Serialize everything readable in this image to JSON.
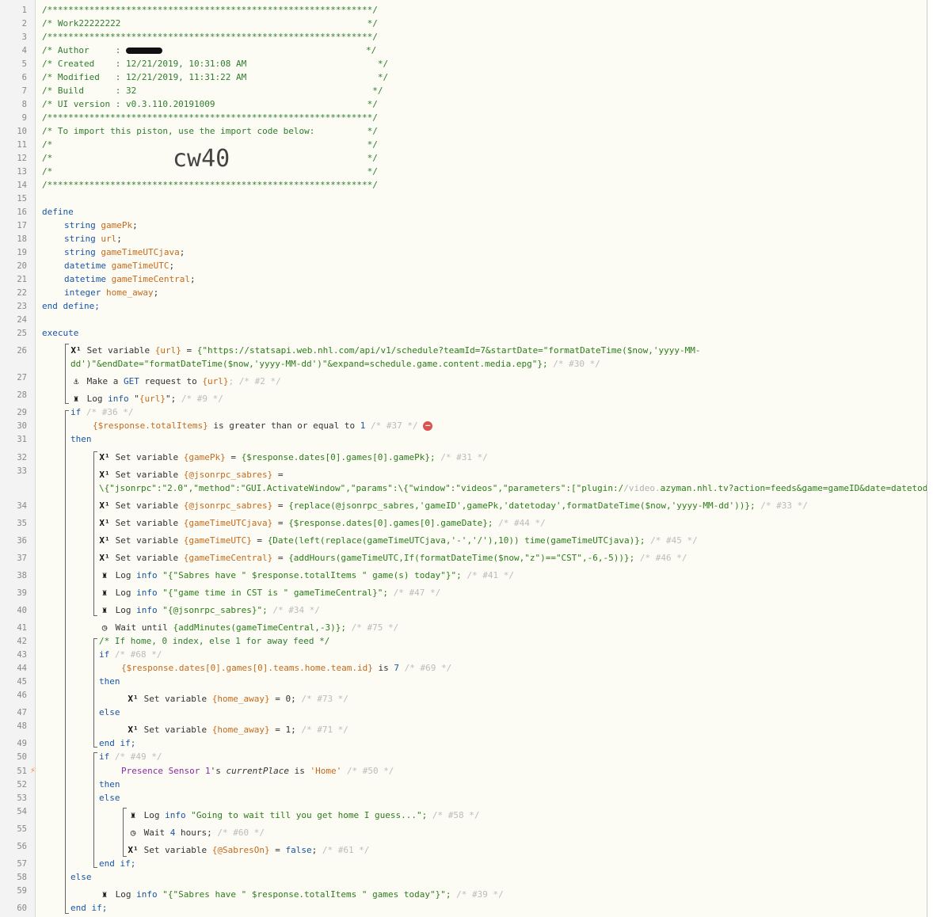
{
  "gutter": {
    "line_numbers": [
      "1",
      "2",
      "3",
      "4",
      "5",
      "6",
      "7",
      "8",
      "9",
      "10",
      "11",
      "12",
      "13",
      "14",
      "15",
      "16",
      "17",
      "18",
      "19",
      "20",
      "21",
      "22",
      "23",
      "24",
      "25",
      "26",
      "27",
      "28",
      "29",
      "30",
      "31",
      "32",
      "33",
      "34",
      "35",
      "36",
      "37",
      "38",
      "39",
      "40",
      "41",
      "42",
      "43",
      "44",
      "45",
      "46",
      "47",
      "48",
      "49",
      "50",
      "51",
      "52",
      "53",
      "54",
      "55",
      "56",
      "57",
      "58",
      "59",
      "60"
    ]
  },
  "header": {
    "stars": "/**************************************************************/",
    "title": "/* Work22222222                                               */",
    "author": "/* Author     :",
    "author_end": "*/",
    "created": "/* Created    : 12/21/2019, 10:31:08 AM                         */",
    "modified": "/* Modified   : 12/21/2019, 11:31:22 AM                         */",
    "build": "/* Build      : 32                                             */",
    "ui_version": "/* UI version : v0.3.110.20191009                             */",
    "import_line": "/* To import this piston, use the import code below:          */",
    "blank": "/*                                                            */",
    "blank_short": "/*                                                            */",
    "import_code": "cw40"
  },
  "define": {
    "kw": "define",
    "vars": [
      {
        "type": "string",
        "name": "gamePk"
      },
      {
        "type": "string",
        "name": "url"
      },
      {
        "type": "string",
        "name": "gameTimeUTCjava"
      },
      {
        "type": "datetime",
        "name": "gameTimeUTC"
      },
      {
        "type": "datetime",
        "name": "gameTimeCentral"
      },
      {
        "type": "integer",
        "name": "home_away"
      }
    ],
    "end": "end define;"
  },
  "execute": {
    "kw": "execute",
    "l26a": "Set variable ",
    "l26var": "{url}",
    "l26b": " = ",
    "l26expr": "{\"https://statsapi.web.nhl.com/api/v1/schedule?teamId=7&startDate=\"formatDateTime($now,'yyyy-MM-",
    "l26expr2": "dd')\"&endDate=\"formatDateTime($now,'yyyy-MM-dd')\"&expand=schedule.game.content.media.epg\"};",
    "l26id": " /* #30 */",
    "l27a": "Make a ",
    "l27b": "GET",
    "l27c": " request to ",
    "l27var": "{url}",
    "l27id": "; /* #2 */",
    "l28a": "Log ",
    "l28b": "info",
    "l28c": " \"",
    "l28var": "{url}",
    "l28d": "\";",
    "l28id": " /* #9 */",
    "if_kw": "if",
    "l29id": " /* #36 */",
    "l30a": "{$response.totalItems}",
    "l30b": " is greater than or equal to ",
    "l30c": "1",
    "l30id": " /* #37 */",
    "then_kw": "then",
    "l32var": "{gamePk}",
    "l32expr": "{$response.dates[0].games[0].gamePk};",
    "l32id": " /* #31 */",
    "l33var": "{@jsonrpc_sabres}",
    "l33expr": "\\{\"jsonrpc\":\"2.0\",\"method\":\"GUI.ActivateWindow\",\"params\":\\{\"window\":\"videos\",\"parameters\":[\"plugin:/",
    "l33hint": "/video.",
    "l33expr2": "azyman.nhl.tv?action=feeds&game=gameID&date=datetoday\"]}}",
    "l34var": "{@jsonrpc_sabres}",
    "l34expr": "{replace(@jsonrpc_sabres,'gameID',gamePk,'datetoday',formatDateTime($now,'yyyy-MM-dd'))};",
    "l34id": " /* #33 */",
    "l35var": "{gameTimeUTCjava}",
    "l35expr": "{$response.dates[0].games[0].gameDate};",
    "l35id": " /* #44 */",
    "l36var": "{gameTimeUTC}",
    "l36expr": "{Date(left(replace(gameTimeUTCjava,'-','/'),10)) time(gameTimeUTCjava)};",
    "l36id": " /* #45 */",
    "l37var": "{gameTimeCentral}",
    "l37expr": "{addHours(gameTimeUTC,If(formatDateTime($now,\"z\")==\"CST\",-6,-5))};",
    "l37id": " /* #46 */",
    "l38expr": "\"{\"Sabres have \" $response.totalItems \" game(s) today\"}\";",
    "l38id": " /* #41 */",
    "l39expr": "\"{\"game time in CST is \" gameTimeCentral}\";",
    "l39id": " /* #47 */",
    "l40expr": "\"{@jsonrpc_sabres}\";",
    "l40id": " /* #34 */",
    "l41a": "Wait until ",
    "l41expr": "{addMinutes(gameTimeCentral,-3)};",
    "l41id": " /* #75 */",
    "l42": "/* If home, 0 index, else 1 for away feed */",
    "l43id": " /* #68 */",
    "l44a": "{$response.dates[0].games[0].teams.home.team.id}",
    "l44b": " is ",
    "l44c": "7",
    "l44id": " /* #69 */",
    "l46var": "{home_away}",
    "l46b": " = 0;",
    "l46id": " /* #73 */",
    "else_kw": "else",
    "l48var": "{home_away}",
    "l48b": " = 1;",
    "l48id": " /* #71 */",
    "endif": "end if;",
    "l50id": " /* #49 */",
    "l51dev": "Presence Sensor 1",
    "l51b": "'s ",
    "l51attr": "currentPlace",
    "l51c": " is ",
    "l51val": "'Home'",
    "l51id": " /* #50 */",
    "l54expr": "\"Going to wait till you get home I guess...\";",
    "l54id": " /* #58 */",
    "l55a": "Wait ",
    "l55b": "4",
    "l55c": " hours;",
    "l55id": " /* #60 */",
    "l56var": "{@SabresOn}",
    "l56b": " = ",
    "l56c": "false",
    "l56d": ";",
    "l56id": " /* #61 */",
    "l59expr": "\"{\"Sabres have \" $response.totalItems \" games today\"}\";",
    "l59id": " /* #39 */",
    "set_variable": "Set variable ",
    "eq": " = ",
    "log": "Log ",
    "info": "info",
    "space": " "
  }
}
